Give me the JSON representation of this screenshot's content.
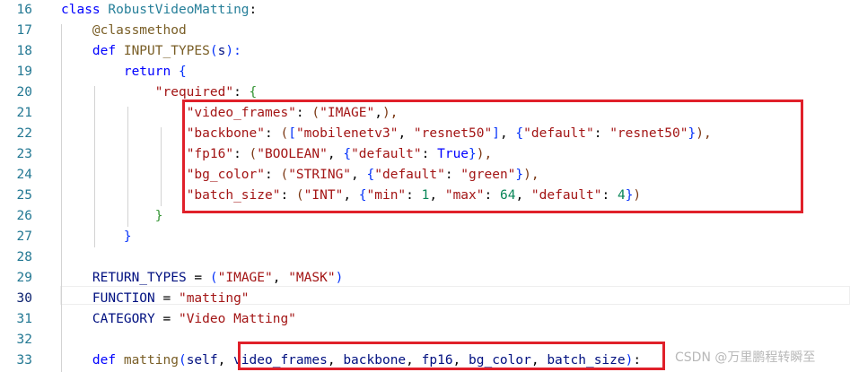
{
  "editor": {
    "active_line": "30",
    "lines": [
      {
        "n": "16",
        "tokens": [
          {
            "t": "class ",
            "c": "t-kw"
          },
          {
            "t": "RobustVideoMatting",
            "c": "t-cls"
          },
          {
            "t": ":",
            "c": "t-p"
          }
        ]
      },
      {
        "n": "17",
        "tokens": [
          {
            "t": "    ",
            "c": "t-p"
          },
          {
            "t": "@classmethod",
            "c": "t-dec"
          }
        ]
      },
      {
        "n": "18",
        "tokens": [
          {
            "t": "    ",
            "c": "t-p"
          },
          {
            "t": "def ",
            "c": "t-kw"
          },
          {
            "t": "INPUT_TYPES",
            "c": "t-fn"
          },
          {
            "t": "(",
            "c": "t-b1"
          },
          {
            "t": "s",
            "c": "t-txt"
          },
          {
            "t": "):",
            "c": "t-b1"
          }
        ]
      },
      {
        "n": "19",
        "tokens": [
          {
            "t": "        ",
            "c": "t-p"
          },
          {
            "t": "return ",
            "c": "t-kw"
          },
          {
            "t": "{",
            "c": "t-b1"
          }
        ]
      },
      {
        "n": "20",
        "tokens": [
          {
            "t": "            ",
            "c": "t-p"
          },
          {
            "t": "\"required\"",
            "c": "t-str"
          },
          {
            "t": ": ",
            "c": "t-p"
          },
          {
            "t": "{",
            "c": "t-b2"
          }
        ]
      },
      {
        "n": "21",
        "tokens": [
          {
            "t": "                ",
            "c": "t-p"
          },
          {
            "t": "\"video_frames\"",
            "c": "t-str"
          },
          {
            "t": ": ",
            "c": "t-p"
          },
          {
            "t": "(",
            "c": "t-b3"
          },
          {
            "t": "\"IMAGE\"",
            "c": "t-str"
          },
          {
            "t": ",",
            "c": "t-p"
          },
          {
            "t": "),",
            "c": "t-b3"
          }
        ]
      },
      {
        "n": "22",
        "tokens": [
          {
            "t": "                ",
            "c": "t-p"
          },
          {
            "t": "\"backbone\"",
            "c": "t-str"
          },
          {
            "t": ": ",
            "c": "t-p"
          },
          {
            "t": "(",
            "c": "t-b3"
          },
          {
            "t": "[",
            "c": "t-b1"
          },
          {
            "t": "\"mobilenetv3\"",
            "c": "t-str"
          },
          {
            "t": ", ",
            "c": "t-p"
          },
          {
            "t": "\"resnet50\"",
            "c": "t-str"
          },
          {
            "t": "]",
            "c": "t-b1"
          },
          {
            "t": ", ",
            "c": "t-p"
          },
          {
            "t": "{",
            "c": "t-b1"
          },
          {
            "t": "\"default\"",
            "c": "t-str"
          },
          {
            "t": ": ",
            "c": "t-p"
          },
          {
            "t": "\"resnet50\"",
            "c": "t-str"
          },
          {
            "t": "}",
            "c": "t-b1"
          },
          {
            "t": "),",
            "c": "t-b3"
          }
        ]
      },
      {
        "n": "23",
        "tokens": [
          {
            "t": "                ",
            "c": "t-p"
          },
          {
            "t": "\"fp16\"",
            "c": "t-str"
          },
          {
            "t": ": ",
            "c": "t-p"
          },
          {
            "t": "(",
            "c": "t-b3"
          },
          {
            "t": "\"BOOLEAN\"",
            "c": "t-str"
          },
          {
            "t": ", ",
            "c": "t-p"
          },
          {
            "t": "{",
            "c": "t-b1"
          },
          {
            "t": "\"default\"",
            "c": "t-str"
          },
          {
            "t": ": ",
            "c": "t-p"
          },
          {
            "t": "True",
            "c": "t-kw"
          },
          {
            "t": "}",
            "c": "t-b1"
          },
          {
            "t": "),",
            "c": "t-b3"
          }
        ]
      },
      {
        "n": "24",
        "tokens": [
          {
            "t": "                ",
            "c": "t-p"
          },
          {
            "t": "\"bg_color\"",
            "c": "t-str"
          },
          {
            "t": ": ",
            "c": "t-p"
          },
          {
            "t": "(",
            "c": "t-b3"
          },
          {
            "t": "\"STRING\"",
            "c": "t-str"
          },
          {
            "t": ", ",
            "c": "t-p"
          },
          {
            "t": "{",
            "c": "t-b1"
          },
          {
            "t": "\"default\"",
            "c": "t-str"
          },
          {
            "t": ": ",
            "c": "t-p"
          },
          {
            "t": "\"green\"",
            "c": "t-str"
          },
          {
            "t": "}",
            "c": "t-b1"
          },
          {
            "t": "),",
            "c": "t-b3"
          }
        ]
      },
      {
        "n": "25",
        "tokens": [
          {
            "t": "                ",
            "c": "t-p"
          },
          {
            "t": "\"batch_size\"",
            "c": "t-str"
          },
          {
            "t": ": ",
            "c": "t-p"
          },
          {
            "t": "(",
            "c": "t-b3"
          },
          {
            "t": "\"INT\"",
            "c": "t-str"
          },
          {
            "t": ", ",
            "c": "t-p"
          },
          {
            "t": "{",
            "c": "t-b1"
          },
          {
            "t": "\"min\"",
            "c": "t-str"
          },
          {
            "t": ": ",
            "c": "t-p"
          },
          {
            "t": "1",
            "c": "t-num"
          },
          {
            "t": ", ",
            "c": "t-p"
          },
          {
            "t": "\"max\"",
            "c": "t-str"
          },
          {
            "t": ": ",
            "c": "t-p"
          },
          {
            "t": "64",
            "c": "t-num"
          },
          {
            "t": ", ",
            "c": "t-p"
          },
          {
            "t": "\"default\"",
            "c": "t-str"
          },
          {
            "t": ": ",
            "c": "t-p"
          },
          {
            "t": "4",
            "c": "t-num"
          },
          {
            "t": "}",
            "c": "t-b1"
          },
          {
            "t": ")",
            "c": "t-b3"
          }
        ]
      },
      {
        "n": "26",
        "tokens": [
          {
            "t": "            ",
            "c": "t-p"
          },
          {
            "t": "}",
            "c": "t-b2"
          }
        ]
      },
      {
        "n": "27",
        "tokens": [
          {
            "t": "        ",
            "c": "t-p"
          },
          {
            "t": "}",
            "c": "t-b1"
          }
        ]
      },
      {
        "n": "28",
        "tokens": []
      },
      {
        "n": "29",
        "tokens": [
          {
            "t": "    ",
            "c": "t-p"
          },
          {
            "t": "RETURN_TYPES",
            "c": "t-txt"
          },
          {
            "t": " = ",
            "c": "t-p"
          },
          {
            "t": "(",
            "c": "t-b1"
          },
          {
            "t": "\"IMAGE\"",
            "c": "t-str"
          },
          {
            "t": ", ",
            "c": "t-p"
          },
          {
            "t": "\"MASK\"",
            "c": "t-str"
          },
          {
            "t": ")",
            "c": "t-b1"
          }
        ]
      },
      {
        "n": "30",
        "tokens": [
          {
            "t": "    ",
            "c": "t-p"
          },
          {
            "t": "FUNCTION",
            "c": "t-txt"
          },
          {
            "t": " = ",
            "c": "t-p"
          },
          {
            "t": "\"matting\"",
            "c": "t-str"
          }
        ]
      },
      {
        "n": "31",
        "tokens": [
          {
            "t": "    ",
            "c": "t-p"
          },
          {
            "t": "CATEGORY",
            "c": "t-txt"
          },
          {
            "t": " = ",
            "c": "t-p"
          },
          {
            "t": "\"Video Matting\"",
            "c": "t-str"
          }
        ]
      },
      {
        "n": "32",
        "tokens": []
      },
      {
        "n": "33",
        "tokens": [
          {
            "t": "    ",
            "c": "t-p"
          },
          {
            "t": "def ",
            "c": "t-kw"
          },
          {
            "t": "matting",
            "c": "t-fn"
          },
          {
            "t": "(",
            "c": "t-b1"
          },
          {
            "t": "self",
            "c": "t-txt"
          },
          {
            "t": ", ",
            "c": "t-p"
          },
          {
            "t": "video_frames",
            "c": "t-txt"
          },
          {
            "t": ", ",
            "c": "t-p"
          },
          {
            "t": "backbone",
            "c": "t-txt"
          },
          {
            "t": ", ",
            "c": "t-p"
          },
          {
            "t": "fp16",
            "c": "t-txt"
          },
          {
            "t": ", ",
            "c": "t-p"
          },
          {
            "t": "bg_color",
            "c": "t-txt"
          },
          {
            "t": ", ",
            "c": "t-p"
          },
          {
            "t": "batch_size",
            "c": "t-txt"
          },
          {
            "t": ")",
            "c": "t-b1"
          },
          {
            "t": ":",
            "c": "t-p"
          }
        ]
      }
    ]
  },
  "watermark": "CSDN @万里鹏程转瞬至"
}
